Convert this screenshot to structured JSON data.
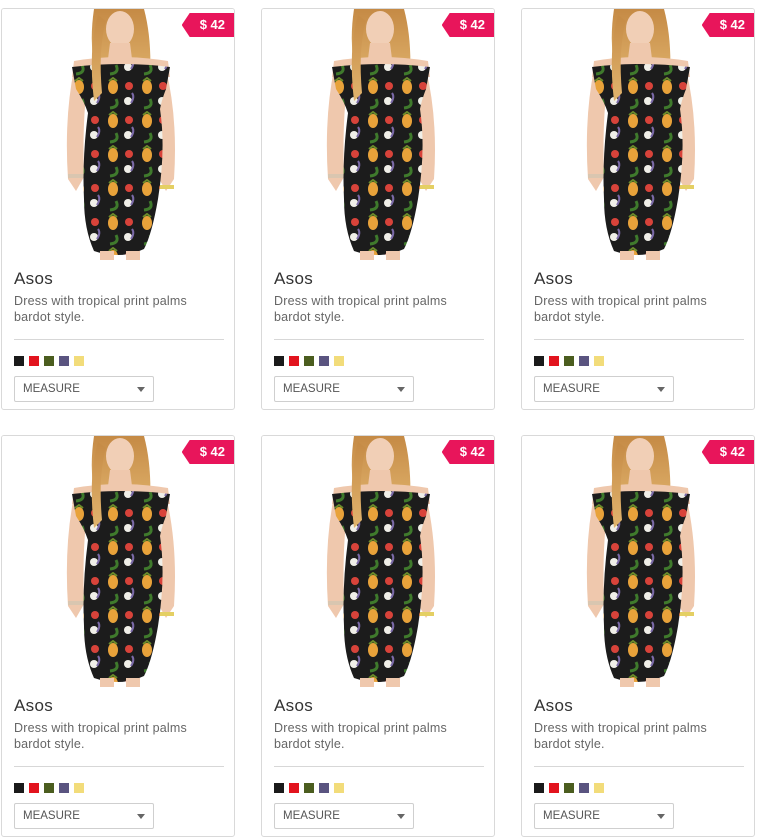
{
  "products": [
    {
      "brand": "Asos",
      "description": "Dress with tropical print palms bardot style.",
      "price": "$ 42",
      "size_select": "MEASURE",
      "swatches": [
        "#1a1a1a",
        "#e2141e",
        "#4b5d1f",
        "#5a5480",
        "#f2dc7a"
      ]
    },
    {
      "brand": "Asos",
      "description": "Dress with tropical print palms bardot style.",
      "price": "$ 42",
      "size_select": "MEASURE",
      "swatches": [
        "#1a1a1a",
        "#e2141e",
        "#4b5d1f",
        "#5a5480",
        "#f2dc7a"
      ]
    },
    {
      "brand": "Asos",
      "description": "Dress with tropical print palms bardot style.",
      "price": "$ 42",
      "size_select": "MEASURE",
      "swatches": [
        "#1a1a1a",
        "#e2141e",
        "#4b5d1f",
        "#5a5480",
        "#f2dc7a"
      ]
    },
    {
      "brand": "Asos",
      "description": "Dress with tropical print palms bardot style.",
      "price": "$ 42",
      "size_select": "MEASURE",
      "swatches": [
        "#1a1a1a",
        "#e2141e",
        "#4b5d1f",
        "#5a5480",
        "#f2dc7a"
      ]
    },
    {
      "brand": "Asos",
      "description": "Dress with tropical print palms bardot style.",
      "price": "$ 42",
      "size_select": "MEASURE",
      "swatches": [
        "#1a1a1a",
        "#e2141e",
        "#4b5d1f",
        "#5a5480",
        "#f2dc7a"
      ]
    },
    {
      "brand": "Asos",
      "description": "Dress with tropical print palms bardot style.",
      "price": "$ 42",
      "size_select": "MEASURE",
      "swatches": [
        "#1a1a1a",
        "#e2141e",
        "#4b5d1f",
        "#5a5480",
        "#f2dc7a"
      ]
    }
  ],
  "colors": {
    "price_tag": "#e8155b",
    "card_border": "#d9d9d9"
  }
}
